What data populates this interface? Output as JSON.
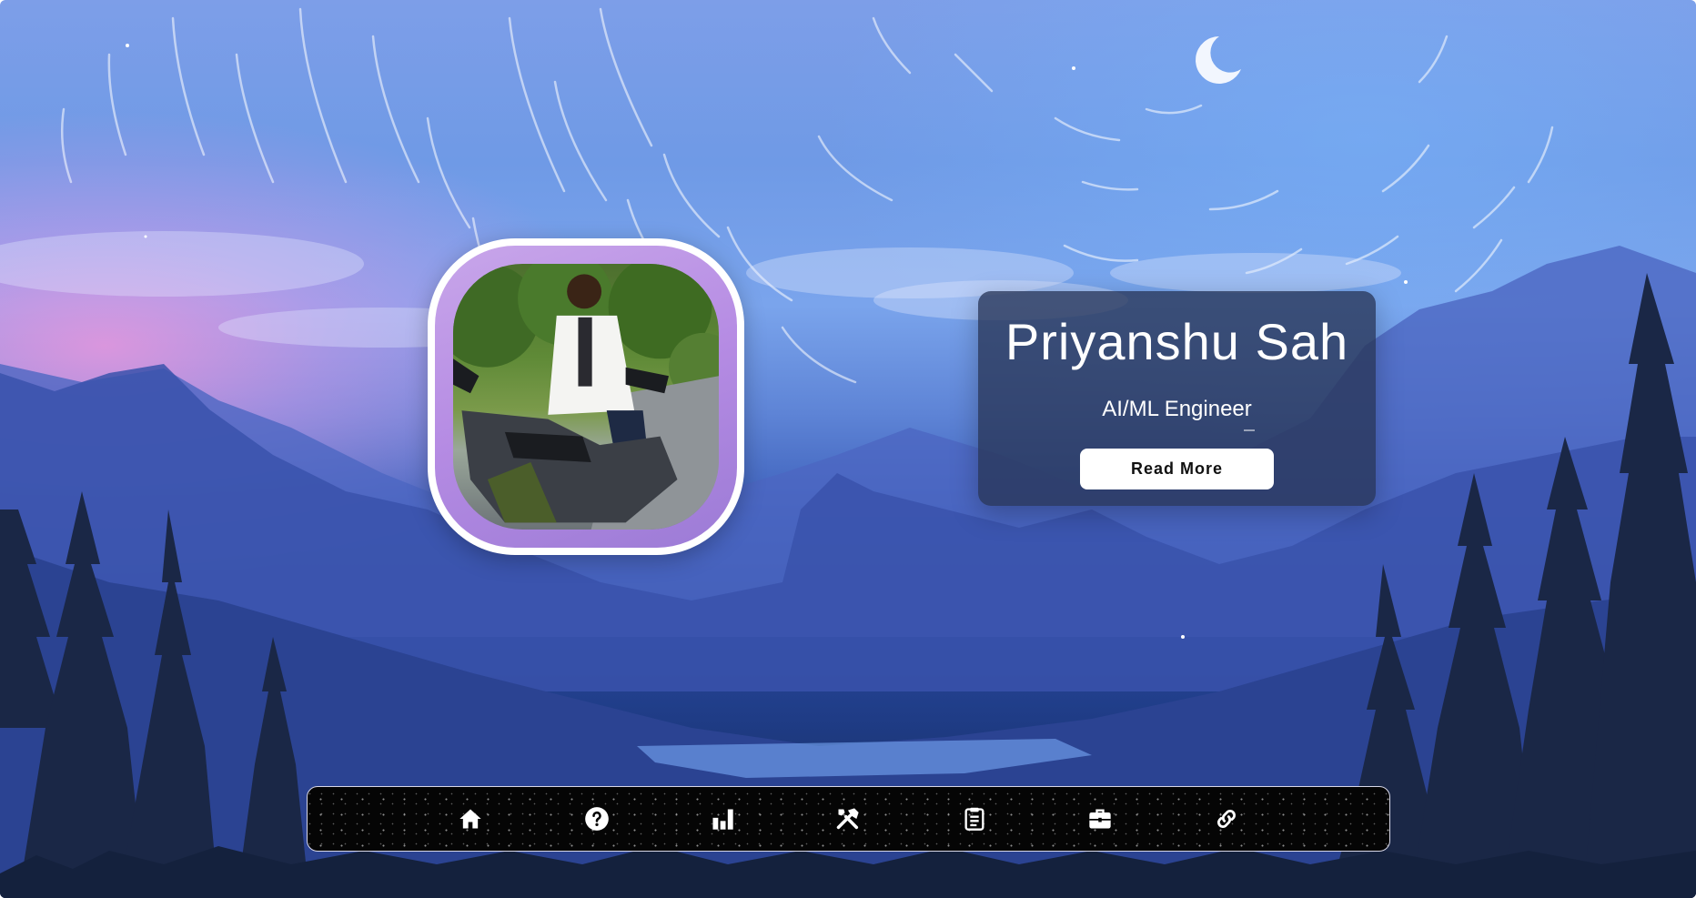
{
  "profile": {
    "photo_alt": "Profile photo of a person on a motorbike",
    "name": "Priyanshu Sah",
    "role": "AI/ML Engineer",
    "read_more_label": "Read More"
  },
  "nav": {
    "items": [
      {
        "icon": "home-icon"
      },
      {
        "icon": "question-circle-icon"
      },
      {
        "icon": "bar-chart-icon"
      },
      {
        "icon": "tools-icon"
      },
      {
        "icon": "clipboard-icon"
      },
      {
        "icon": "briefcase-icon"
      },
      {
        "icon": "link-icon"
      }
    ]
  },
  "colors": {
    "card_bg": "#283456",
    "button_bg": "#ffffff",
    "nav_bg": "#050505",
    "frame_border": "#ffffff"
  }
}
